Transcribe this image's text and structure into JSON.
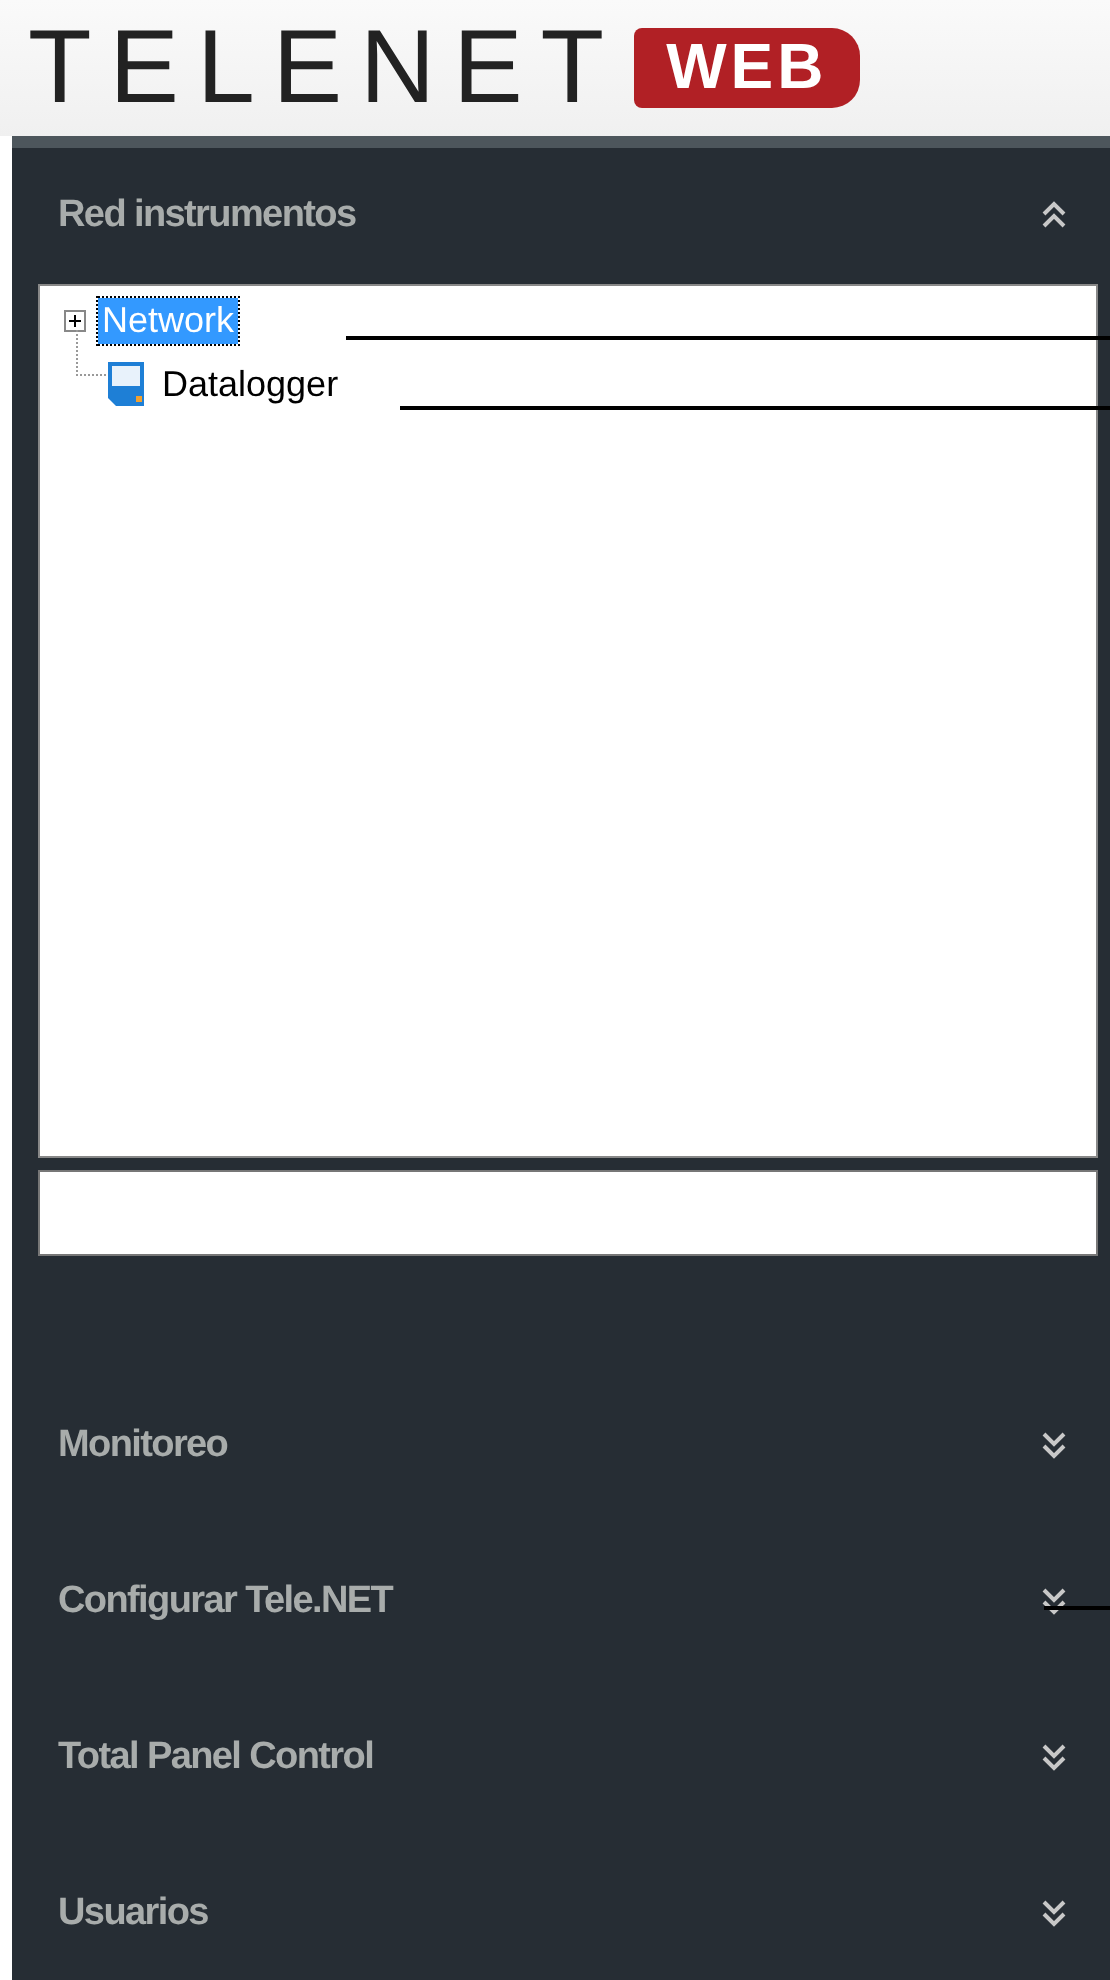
{
  "logo": {
    "text": "TELENET",
    "badge": "WEB"
  },
  "sections": [
    {
      "title": "Red instrumentos",
      "expanded": true,
      "tree": [
        {
          "label": "Network",
          "kind": "folder",
          "expanded": false,
          "selected": true
        },
        {
          "label": "Datalogger",
          "kind": "device",
          "selected": false
        }
      ]
    },
    {
      "title": "Monitoreo",
      "expanded": false
    },
    {
      "title": "Configurar Tele.NET",
      "expanded": false
    },
    {
      "title": "Total Panel Control",
      "expanded": false
    },
    {
      "title": "Usuarios",
      "expanded": false
    }
  ]
}
